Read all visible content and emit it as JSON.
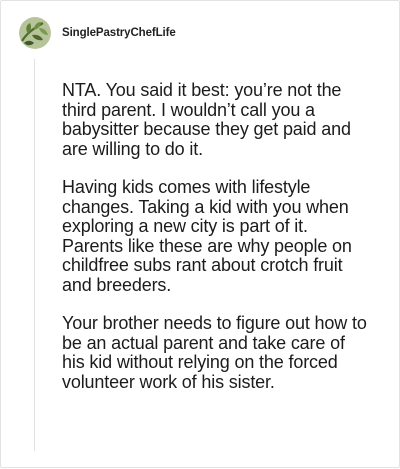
{
  "post": {
    "username": "SinglePastryChefLife",
    "avatar_icon": "leaf-avatar-icon",
    "paragraphs": [
      "NTA. You said it best: you’re not the third parent. I wouldn’t call you a babysitter because they get paid and are willing to do it.",
      "Having kids comes with lifestyle changes. Taking a kid with you when exploring a new city is part of it. Parents like these are why people on childfree subs rant about crotch fruit and breeders.",
      "Your brother needs to figure out how to be an actual parent and take care of his kid without relying on the forced volunteer work of his sister."
    ]
  }
}
